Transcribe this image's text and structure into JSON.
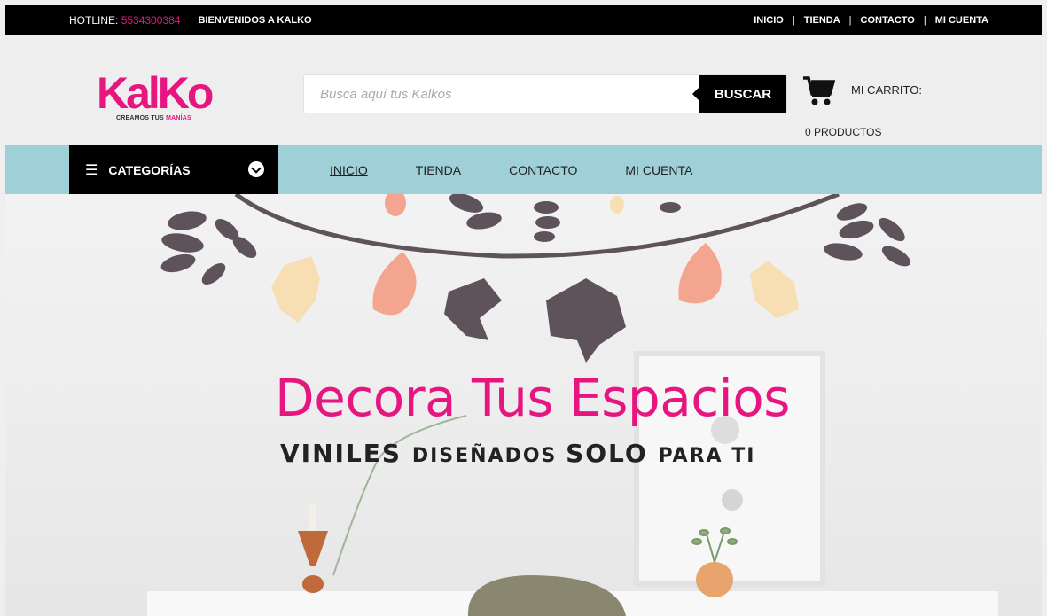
{
  "topbar": {
    "hotline_label": "HOTLINE:",
    "hotline_number": "5534300384",
    "welcome": "BIENVENIDOS A KALKO",
    "links": [
      "INICIO",
      "TIENDA",
      "CONTACTO",
      "MI CUENTA"
    ]
  },
  "header": {
    "logo_text": "KalKo",
    "logo_tag_black": "CREAMOS TUS ",
    "logo_tag_pink": "MANÍAS",
    "search_placeholder": "Busca aquí tus Kalkos",
    "search_button": "BUSCAR",
    "cart_label": "MI CARRITO:",
    "cart_count": "0 PRODUCTOS"
  },
  "nav": {
    "categories_label": "CATEGORÍAS",
    "links": [
      "INICIO",
      "TIENDA",
      "CONTACTO",
      "MI CUENTA"
    ]
  },
  "hero": {
    "title": "Decora Tus Espacios",
    "subtitle_big1": "VINILES ",
    "subtitle_sm1": "DISEÑADOS ",
    "subtitle_big2": "SOLO ",
    "subtitle_sm2": "PARA TI"
  },
  "colors": {
    "brand_pink": "#e6157f",
    "nav_teal": "#9fd0d8",
    "leaf_dark": "#5e535a",
    "leaf_peach": "#f4a58f",
    "leaf_cream": "#f8dfb3"
  },
  "icons": [
    "cart-icon",
    "hamburger-icon",
    "chevron-down-icon"
  ]
}
